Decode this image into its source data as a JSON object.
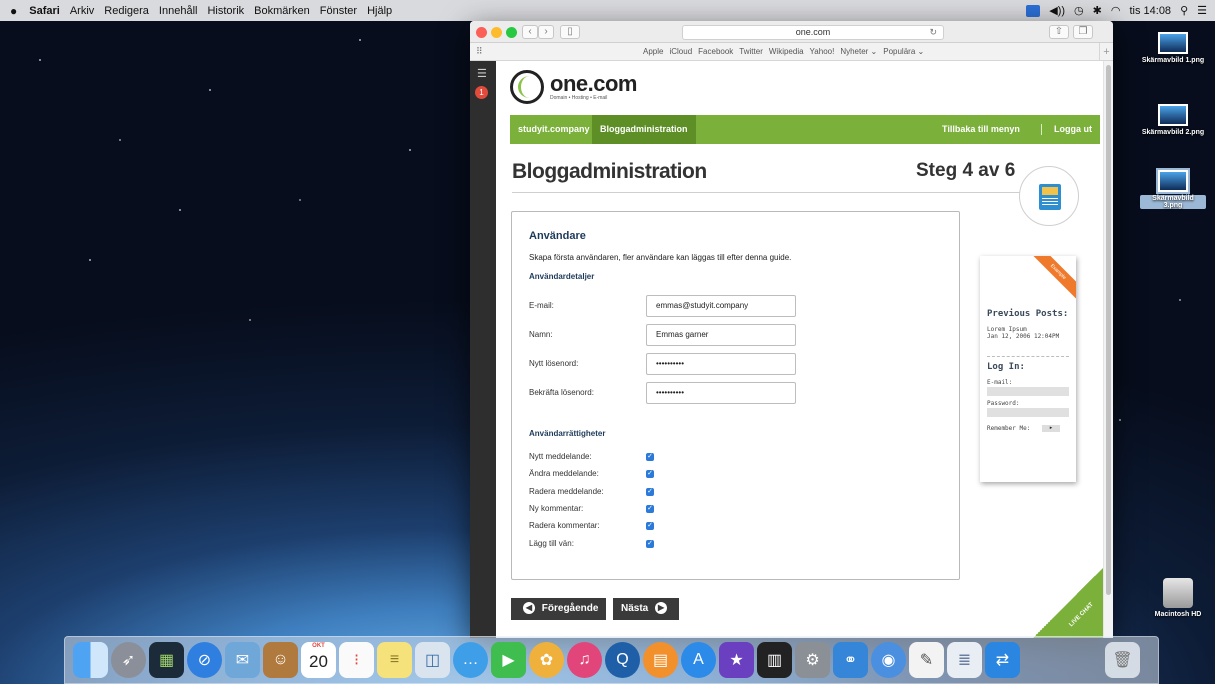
{
  "menubar": {
    "apple_icon": "apple-icon",
    "items": [
      "Safari",
      "Arkiv",
      "Redigera",
      "Innehåll",
      "Historik",
      "Bokmärken",
      "Fönster",
      "Hjälp"
    ],
    "clock": "tis 14:08"
  },
  "browser": {
    "url": "one.com",
    "favorites": [
      "Apple",
      "iCloud",
      "Facebook",
      "Twitter",
      "Wikipedia",
      "Yahoo!",
      "Nyheter ⌄",
      "Populära ⌄"
    ],
    "sidebar_badge": "1"
  },
  "site": {
    "logo_text": "one.com",
    "logo_tagline": "Domain • Hosting • E-mail",
    "nav": {
      "domain": "studyit.company",
      "active": "Bloggadministration",
      "back": "Tillbaka till menyn",
      "logout": "Logga ut"
    },
    "title": "Bloggadministration",
    "step": "Steg 4 av 6"
  },
  "form": {
    "heading": "Användare",
    "description": "Skapa första användaren, fler användare kan läggas till efter denna guide.",
    "details_heading": "Användardetaljer",
    "fields": [
      {
        "label": "E-mail:",
        "value": "emmas@studyit.company"
      },
      {
        "label": "Namn:",
        "value": "Emmas garner"
      },
      {
        "label": "Nytt lösenord:",
        "value": "••••••••••"
      },
      {
        "label": "Bekräfta lösenord:",
        "value": "••••••••••"
      }
    ],
    "rights_heading": "Användarrättigheter",
    "rights": [
      {
        "label": "Nytt meddelande:",
        "checked": true
      },
      {
        "label": "Ändra meddelande:",
        "checked": true
      },
      {
        "label": "Radera meddelande:",
        "checked": true
      },
      {
        "label": "Ny kommentar:",
        "checked": true
      },
      {
        "label": "Radera kommentar:",
        "checked": true
      },
      {
        "label": "Lägg till vän:",
        "checked": true
      }
    ]
  },
  "widget": {
    "ribbon": "Example",
    "previous_posts": "Previous Posts:",
    "post_title": "Lorem Ipsum",
    "post_date": "Jan 12, 2006 12:04PM",
    "login": "Log In:",
    "email_label": "E-mail:",
    "password_label": "Password:",
    "remember": "Remember Me:"
  },
  "buttons": {
    "prev": "Föregående",
    "next": "Nästa"
  },
  "livechat": "LIVE CHAT",
  "desktop": {
    "icons": [
      "Skärmavbild 1.png",
      "Skärmavbild 2.png",
      "Skärmavbild 3.png"
    ],
    "hd": "Macintosh HD"
  },
  "dock": {
    "calendar_month": "OKT",
    "calendar_day": "20"
  }
}
